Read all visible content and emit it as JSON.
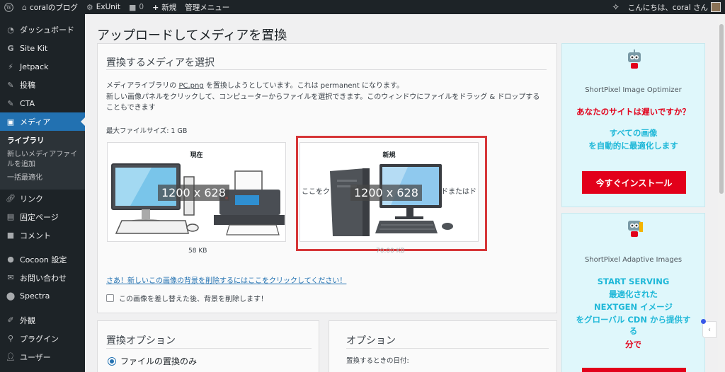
{
  "adminbar": {
    "wp_logo": "wordpress-icon",
    "site_name": "coralのブログ",
    "exunit": "ExUnit",
    "comments_count": "0",
    "new_label": "新規",
    "admin_menu": "管理メニュー",
    "greeting": "こんにちは、coral さん"
  },
  "sidebar": {
    "items": [
      {
        "label": "ダッシュボード",
        "icon": "dashboard-icon"
      },
      {
        "label": "Site Kit",
        "icon": "sitekit-icon"
      },
      {
        "label": "Jetpack",
        "icon": "jetpack-icon"
      },
      {
        "label": "投稿",
        "icon": "pin-icon"
      },
      {
        "label": "CTA",
        "icon": "pin-icon"
      },
      {
        "label": "メディア",
        "icon": "media-icon"
      },
      {
        "label": "リンク",
        "icon": "link-icon"
      },
      {
        "label": "固定ページ",
        "icon": "page-icon"
      },
      {
        "label": "コメント",
        "icon": "comment-icon"
      },
      {
        "label": "Cocoon 設定",
        "icon": "circle-icon"
      },
      {
        "label": "お問い合わせ",
        "icon": "mail-icon"
      },
      {
        "label": "Spectra",
        "icon": "spectra-icon"
      },
      {
        "label": "外観",
        "icon": "brush-icon"
      },
      {
        "label": "プラグイン",
        "icon": "plugin-icon"
      },
      {
        "label": "ユーザー",
        "icon": "user-icon"
      }
    ],
    "submenu": {
      "library": "ライブラリ",
      "add_new": "新しいメディアファイルを追加",
      "bulk": "一括最適化"
    }
  },
  "page": {
    "title": "アップロードしてメディアを置換",
    "select": {
      "heading": "置換するメディアを選択",
      "info_prefix": "メディアライブラリの ",
      "file_name": "PC.png",
      "info_suffix": " を置換しようとしています。これは permanent になります。",
      "info_line2": "新しい画像パネルをクリックして、コンピューターからファイルを選択できます。このウィンドウにファイルをドラッグ & ドロップすることもできます",
      "max_size": "最大ファイルサイズ: 1 GB",
      "current_label": "現在",
      "new_label": "新規",
      "current_dim": "1200 x 628",
      "new_dim": "1200 x 628",
      "drop_left": "ここをク",
      "drop_right": "ドまたはド",
      "current_size": "58 KB",
      "new_size": "70.00 KB",
      "bg_link": "さあ！新しいこの画像の背景を削除するにはここをクリックしてください！",
      "bg_checkbox": "この画像を差し替えた後、背景を削除します！"
    },
    "replace": {
      "heading": "置換オプション",
      "radio_label": "ファイルの置換のみ"
    },
    "options": {
      "heading": "オプション",
      "date_label": "置換するときの日付:"
    }
  },
  "ads": {
    "ad1": {
      "name": "ShortPixel Image Optimizer",
      "question": "あなたのサイトは遅いですか？",
      "line1": "すべての画像",
      "line2": "を自動的に最適化します",
      "button": "今すぐインストール"
    },
    "ad2": {
      "name": "ShortPixel Adaptive Images",
      "line1": "START SERVING",
      "line2": "最適化された",
      "line3": "NEXTGEN イメージ",
      "line4": "をグローバル CDN から提供す",
      "line5": "る",
      "line6": "分で"
    }
  },
  "colors": {
    "accent": "#2271b1",
    "highlight": "#d63638",
    "ad_red": "#e2001a",
    "ad_cyan": "#1fb8d8"
  }
}
